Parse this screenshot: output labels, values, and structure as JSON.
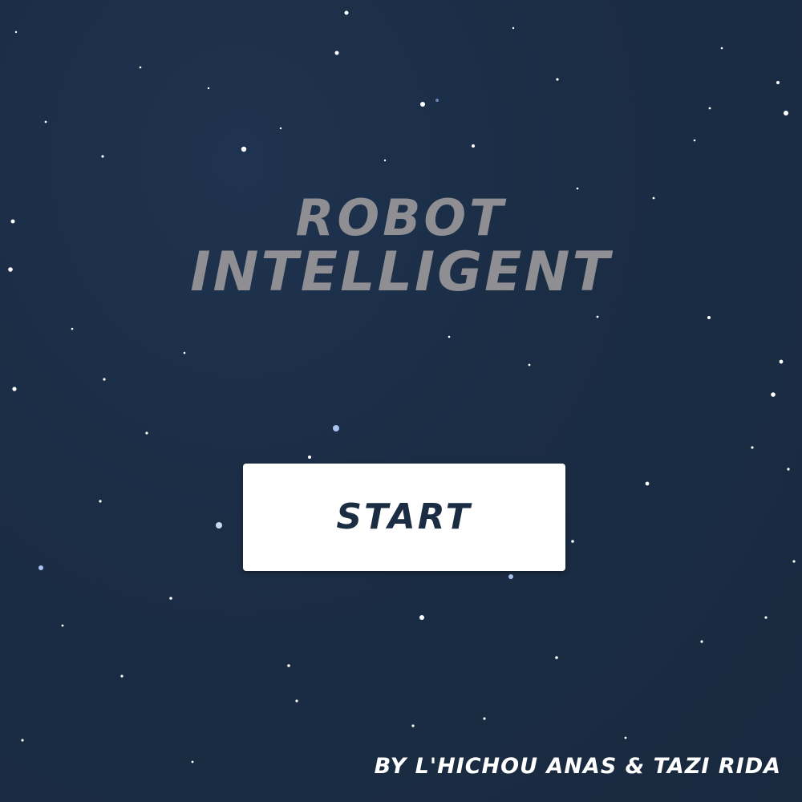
{
  "app": {
    "title_line_1": "ROBOT",
    "title_line_2": "INTELLIGENT",
    "start_label": "START",
    "credits": "BY L'HICHOU ANAS & TAZI RIDA"
  },
  "colors": {
    "background": "#1b2d45",
    "title": "#8f8e93",
    "button_bg": "#ffffff",
    "button_text": "#1a2d42",
    "credits": "#ffffff",
    "stars": "#ffffff"
  }
}
